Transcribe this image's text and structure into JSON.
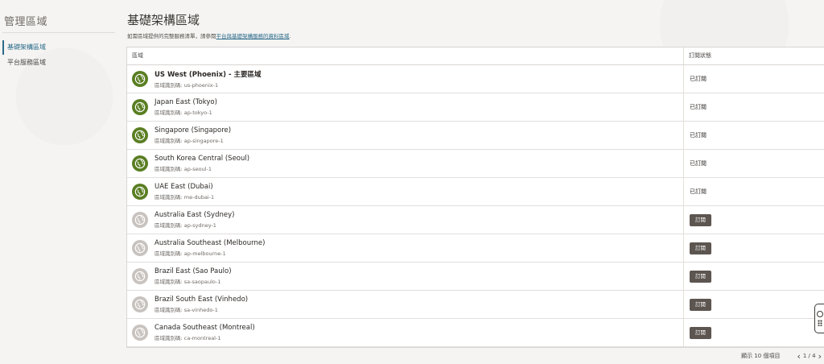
{
  "sidebar": {
    "title": "管理區域",
    "items": [
      {
        "label": "基礎架構區域",
        "active": true
      },
      {
        "label": "平台服務區域",
        "active": false
      }
    ]
  },
  "main": {
    "title": "基礎架構區域",
    "subtitle_prefix": "如需區域提供的完整服務清單，請參閱",
    "subtitle_link": "平台與基礎架構服務的資料區域",
    "subtitle_suffix": "."
  },
  "table": {
    "headers": {
      "region": "區域",
      "status": "訂閱狀態"
    },
    "id_label": "區域識別碼:",
    "rows": [
      {
        "name": "US West (Phoenix) - 主要區域",
        "id": "us-phoenix-1",
        "subscribed": true,
        "primary": true
      },
      {
        "name": "Japan East (Tokyo)",
        "id": "ap-tokyo-1",
        "subscribed": true,
        "primary": false
      },
      {
        "name": "Singapore (Singapore)",
        "id": "ap-singapore-1",
        "subscribed": true,
        "primary": false
      },
      {
        "name": "South Korea Central (Seoul)",
        "id": "ap-seoul-1",
        "subscribed": true,
        "primary": false
      },
      {
        "name": "UAE East (Dubai)",
        "id": "me-dubai-1",
        "subscribed": true,
        "primary": false
      },
      {
        "name": "Australia East (Sydney)",
        "id": "ap-sydney-1",
        "subscribed": false,
        "primary": false
      },
      {
        "name": "Australia Southeast (Melbourne)",
        "id": "ap-melbourne-1",
        "subscribed": false,
        "primary": false
      },
      {
        "name": "Brazil East (Sao Paulo)",
        "id": "sa-saopaulo-1",
        "subscribed": false,
        "primary": false
      },
      {
        "name": "Brazil South East (Vinhedo)",
        "id": "sa-vinhedo-1",
        "subscribed": false,
        "primary": false
      },
      {
        "name": "Canada Southeast (Montreal)",
        "id": "ca-montreal-1",
        "subscribed": false,
        "primary": false
      }
    ],
    "subscribed_label": "已訂閱",
    "subscribe_button": "訂閱"
  },
  "pager": {
    "showing": "顯示 10 個項目",
    "page": "1 / 4",
    "prev_icon": "chevron-left-icon",
    "next_icon": "chevron-right-icon"
  },
  "colors": {
    "subscribed_globe": "#5a7e23",
    "unsubscribed_globe": "#c8c3bf",
    "link": "#2b6b8b",
    "button": "#5c5550"
  }
}
